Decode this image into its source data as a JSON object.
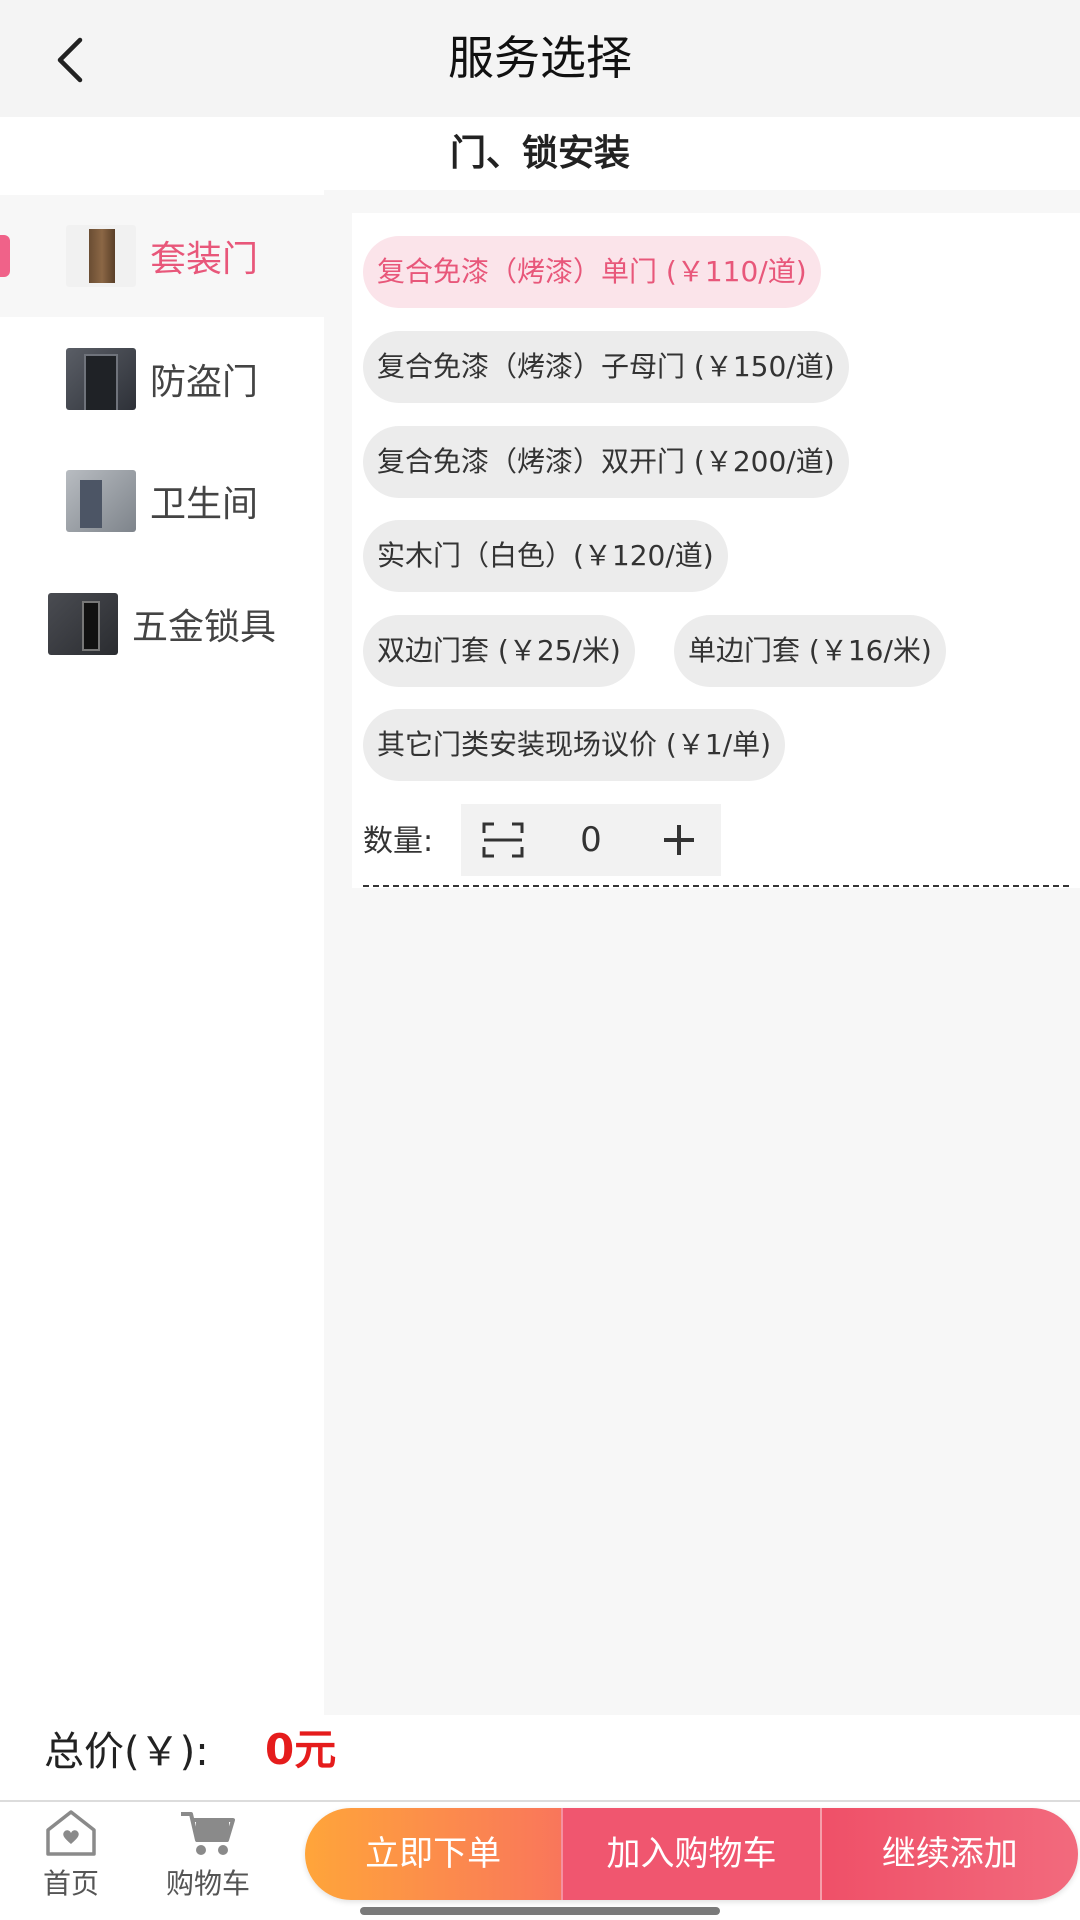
{
  "header": {
    "title": "服务选择"
  },
  "section": {
    "title": "门、锁安装"
  },
  "sidebar": {
    "items": [
      {
        "label": "套装门",
        "active": true
      },
      {
        "label": "防盗门",
        "active": false
      },
      {
        "label": "卫生间",
        "active": false
      },
      {
        "label": "五金锁具",
        "active": false
      }
    ]
  },
  "options": [
    {
      "label": "复合免漆（烤漆）单门 (￥110/道)",
      "selected": true
    },
    {
      "label": "复合免漆（烤漆）子母门 (￥150/道)",
      "selected": false
    },
    {
      "label": "复合免漆（烤漆）双开门 (￥200/道)",
      "selected": false
    },
    {
      "label": "实木门（白色）(￥120/道)",
      "selected": false
    },
    {
      "label": "双边门套 (￥25/米)",
      "selected": false
    },
    {
      "label": "单边门套 (￥16/米)",
      "selected": false
    },
    {
      "label": "其它门类安装现场议价 (￥1/单)",
      "selected": false
    }
  ],
  "quantity": {
    "label": "数量:",
    "value": "0"
  },
  "total": {
    "label": "总价(￥):",
    "value": "0元"
  },
  "nav": {
    "home_label": "首页",
    "cart_label": "购物车"
  },
  "actions": {
    "order_label": "立即下单",
    "add_cart_label": "加入购物车",
    "continue_label": "继续添加"
  },
  "colors": {
    "accent": "#e8577a",
    "price": "#e51c1c",
    "order_gradient_start": "#ffa53a",
    "cart_button": "#f0566f"
  }
}
